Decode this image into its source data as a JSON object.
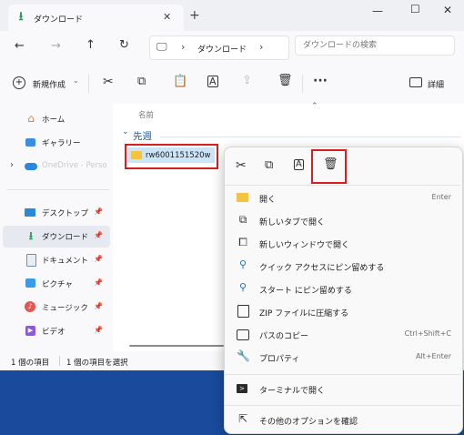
{
  "window": {
    "tab_title": "ダウンロード",
    "new_tab_icon": "plus-icon",
    "controls": [
      "minimize-icon",
      "maximize-icon",
      "close-icon"
    ]
  },
  "nav": {
    "breadcrumb": "ダウンロード",
    "search_placeholder": "ダウンロードの検索"
  },
  "commandbar": {
    "new_label": "新規作成",
    "details_label": "詳細"
  },
  "sidebar": {
    "items": [
      {
        "label": "ホーム",
        "icon": "home-icon"
      },
      {
        "label": "ギャラリー",
        "icon": "gallery-icon"
      },
      {
        "label": "OneDrive - Perso",
        "icon": "onedrive-icon"
      },
      {
        "label": "デスクトップ",
        "icon": "desktop-icon"
      },
      {
        "label": "ダウンロード",
        "icon": "download-icon"
      },
      {
        "label": "ドキュメント",
        "icon": "document-icon"
      },
      {
        "label": "ピクチャ",
        "icon": "picture-icon"
      },
      {
        "label": "ミュージック",
        "icon": "music-icon"
      },
      {
        "label": "ビデオ",
        "icon": "video-icon"
      }
    ]
  },
  "content": {
    "column_name": "名前",
    "group_label": "先週",
    "file_name": "rw6001151520w"
  },
  "status": {
    "item_count": "1 個の項目",
    "selected": "1 個の項目を選択"
  },
  "context_menu": {
    "toolbar_icons": [
      "cut-icon",
      "copy-icon",
      "rename-icon",
      "delete-icon"
    ],
    "items": [
      {
        "label": "開く",
        "shortcut": "Enter",
        "icon": "open-folder-icon"
      },
      {
        "label": "新しいタブで開く",
        "shortcut": "",
        "icon": "new-tab-icon"
      },
      {
        "label": "新しいウィンドウで開く",
        "shortcut": "",
        "icon": "new-window-icon"
      },
      {
        "label": "クイック アクセスにピン留めする",
        "shortcut": "",
        "icon": "pin-icon"
      },
      {
        "label": "スタート にピン留めする",
        "shortcut": "",
        "icon": "pin-start-icon"
      },
      {
        "label": "ZIP ファイルに圧縮する",
        "shortcut": "",
        "icon": "zip-icon"
      },
      {
        "label": "パスのコピー",
        "shortcut": "Ctrl+Shift+C",
        "icon": "copy-path-icon"
      },
      {
        "label": "プロパティ",
        "shortcut": "Alt+Enter",
        "icon": "properties-icon"
      },
      {
        "label": "ターミナルで開く",
        "shortcut": "",
        "icon": "terminal-icon"
      },
      {
        "label": "その他のオプションを確認",
        "shortcut": "",
        "icon": "more-options-icon"
      }
    ]
  },
  "colors": {
    "accent": "#0067c0",
    "highlight_red": "#d81e1e",
    "folder": "#f5c242",
    "desktop_bg": "#1a4a9c"
  }
}
